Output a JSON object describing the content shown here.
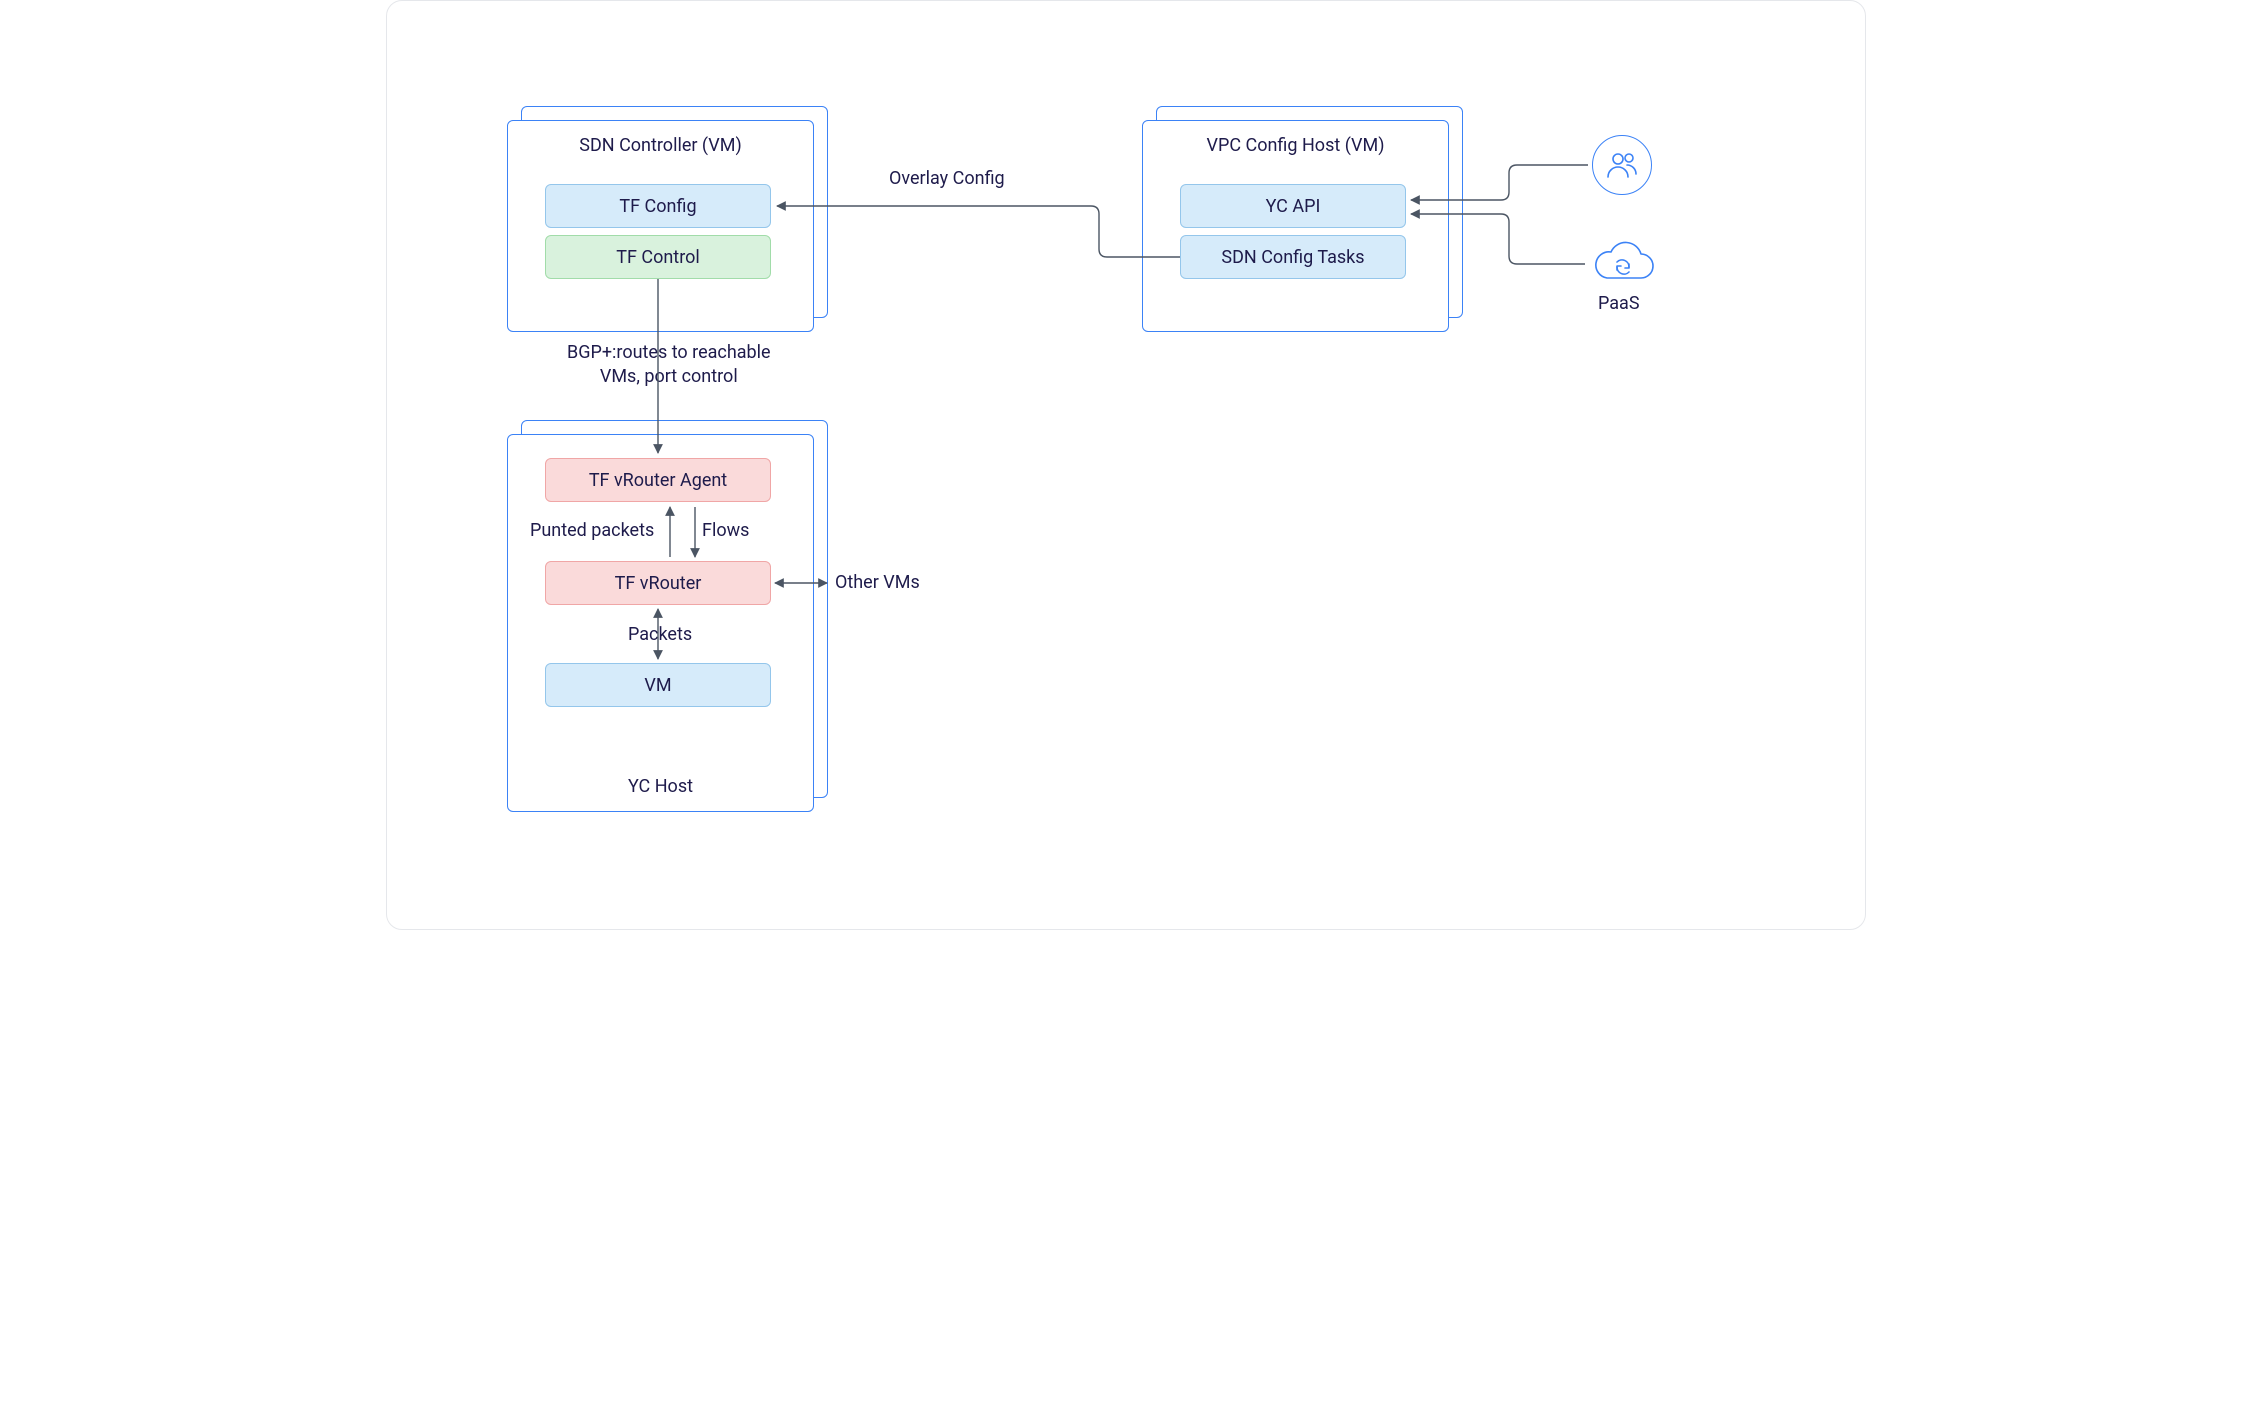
{
  "groups": {
    "sdn_controller": {
      "title": "SDN Controller (VM)"
    },
    "vpc_config_host": {
      "title": "VPC Config Host (VM)"
    },
    "yc_host": {
      "title": "YC Host"
    }
  },
  "chips": {
    "tf_config": "TF Config",
    "tf_control": "TF Control",
    "yc_api": "YC API",
    "sdn_config_tasks": "SDN Config Tasks",
    "tf_vrouter_agent": "TF vRouter Agent",
    "tf_vrouter": "TF vRouter",
    "vm": "VM"
  },
  "labels": {
    "overlay_config": "Overlay Config",
    "bgp_routes": "BGP+:routes to reachable\nVMs, port control",
    "punted_packets": "Punted packets",
    "flows": "Flows",
    "packets": "Packets",
    "other_vms": "Other VMs",
    "paas": "PaaS"
  },
  "icons": {
    "users": "users-icon",
    "cloud_sync": "cloud-sync-icon"
  },
  "colors": {
    "border_blue": "#3b82f6",
    "chip_blue": "#D6EBFA",
    "chip_green": "#D9F2DD",
    "chip_red": "#FADADA",
    "connector": "#4b5563"
  }
}
